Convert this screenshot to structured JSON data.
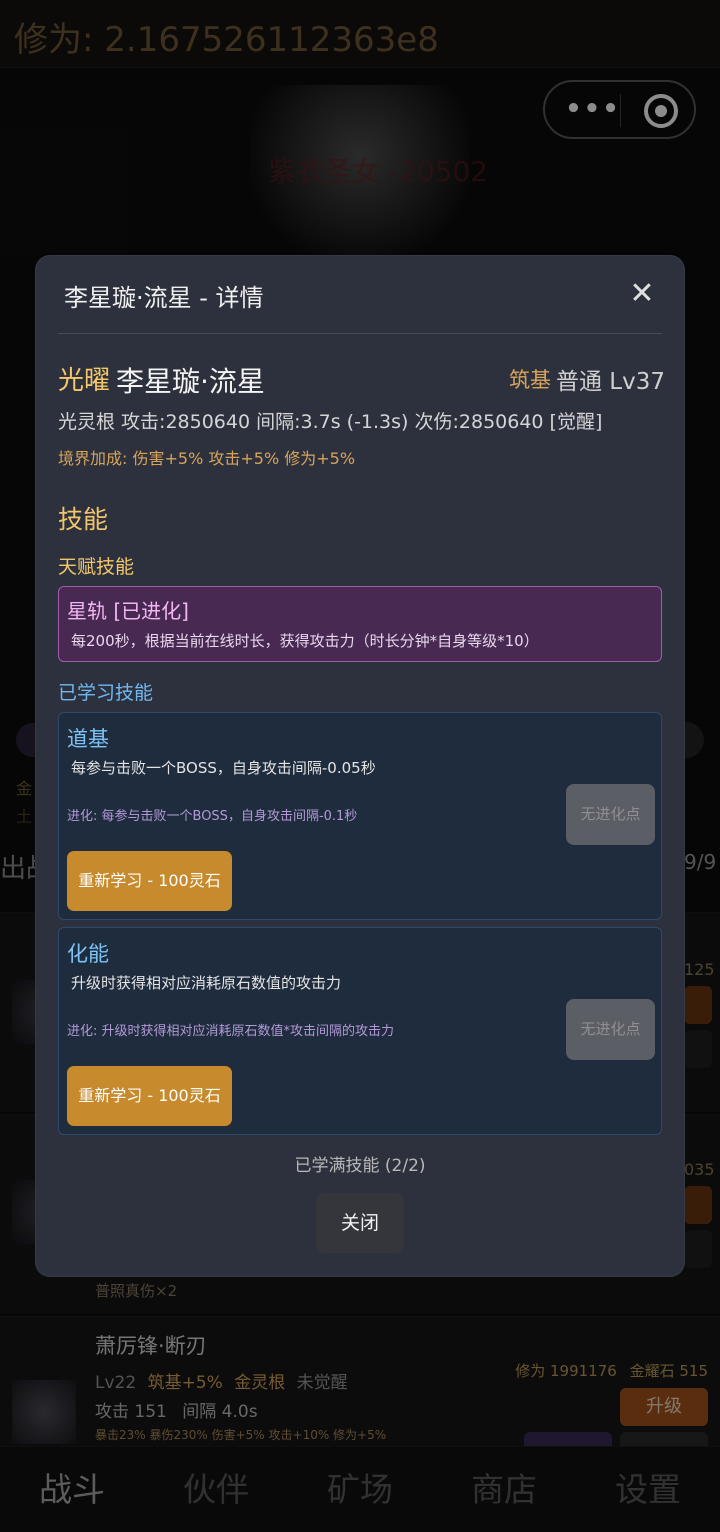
{
  "background": {
    "cultivation_label": "修为: 2.167526112363e8",
    "capsule_dots": "•••",
    "boss_name": "紫衣圣女 -20502",
    "gold_1": "金",
    "gold_2": "土",
    "out_label": "出战",
    "count": "9/9",
    "card_num_1": "125",
    "card_num_2": "035",
    "card_note": "普照真伤×2",
    "hero": {
      "name": "萧厉锋·断刃",
      "level": "Lv22",
      "realm_bonus": "筑基+5%",
      "root": "金灵根",
      "awaken": "未觉醒",
      "attack": "攻击 151",
      "interval": "间隔 4.0s",
      "extra": "暴击23% 暴伤230% 伤害+5% 攻击+10% 修为+5%",
      "cultivation": "修为 1991176",
      "stone": "金耀石 515",
      "upgrade": "升级"
    },
    "nav": [
      "战斗",
      "伙伴",
      "矿场",
      "商店",
      "设置"
    ]
  },
  "modal": {
    "title": "李星璇·流星 - 详情",
    "close_icon": "✕",
    "rank": "光曜",
    "name": "李星璇·流星",
    "realm": "筑基",
    "grade": "普通 Lv37",
    "stats": "光灵根  攻击:2850640  间隔:3.7s (-1.3s)  次伤:2850640 [觉醒]",
    "bonus": "境界加成: 伤害+5%  攻击+5%  修为+5%",
    "skills_title": "技能",
    "talent_label": "天赋技能",
    "talent": {
      "name": "星轨 [已进化]",
      "desc": "每200秒，根据当前在线时长，获得攻击力（时长分钟*自身等级*10）"
    },
    "learned_label": "已学习技能",
    "skills": [
      {
        "name": "道基",
        "desc": "每参与击败一个BOSS，自身攻击间隔-0.05秒",
        "evo": "进化: 每参与击败一个BOSS，自身攻击间隔-0.1秒",
        "no_evo": "无进化点",
        "relearn": "重新学习 - 100灵石"
      },
      {
        "name": "化能",
        "desc": "升级时获得相对应消耗原石数值的攻击力",
        "evo": "进化: 升级时获得相对应消耗原石数值*攻击间隔的攻击力",
        "no_evo": "无进化点",
        "relearn": "重新学习 - 100灵石"
      }
    ],
    "learned_status": "已学满技能 (2/2)",
    "close_button": "关闭"
  }
}
